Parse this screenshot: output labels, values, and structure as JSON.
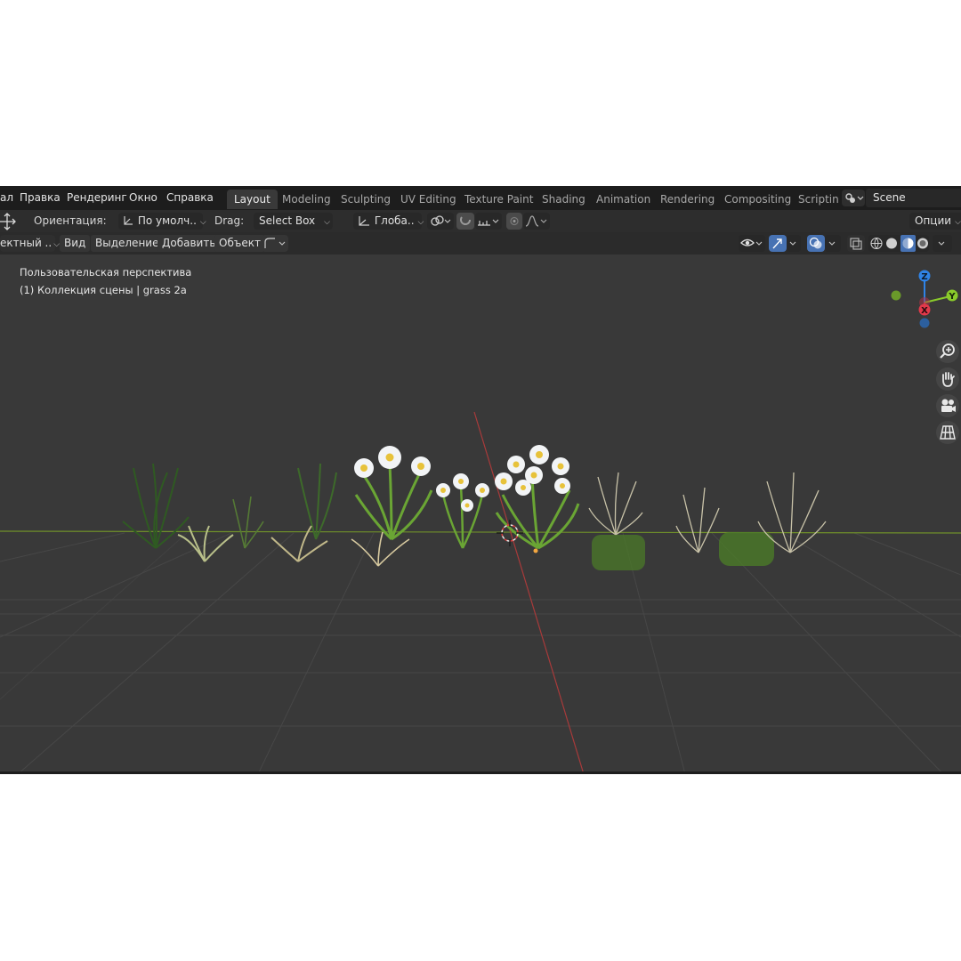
{
  "menu": {
    "items": [
      "ал",
      "Правка",
      "Рендеринг",
      "Окно",
      "Справка"
    ]
  },
  "workspaces": {
    "active": "Layout",
    "tabs": [
      "Layout",
      "Modeling",
      "Sculpting",
      "UV Editing",
      "Texture Paint",
      "Shading",
      "Animation",
      "Rendering",
      "Compositing",
      "Scriptin"
    ]
  },
  "scene": {
    "name": "Scene"
  },
  "tool_settings": {
    "orientation_label": "Ориентация:",
    "orientation_value": "По умолч..",
    "drag_label": "Drag:",
    "drag_value": "Select Box",
    "transform_orientation": "Глоба..",
    "options_label": "Опции"
  },
  "viewport_header": {
    "mode": "ектный ..",
    "view": "Вид",
    "select": "Выделение",
    "add": "Добавить",
    "object": "Объект"
  },
  "viewport": {
    "perspective": "Пользовательская перспектива",
    "collection": "(1) Коллекция сцены | grass 2a"
  },
  "gizmo": {
    "z": "Z",
    "y": "Y",
    "x": "X"
  },
  "colors": {
    "bg": "#393939",
    "header": "#1d1d1d",
    "x_axis": "#e2394a",
    "y_axis": "#8acb2b",
    "z_axis": "#2f83e6",
    "accent": "#4772b3"
  }
}
